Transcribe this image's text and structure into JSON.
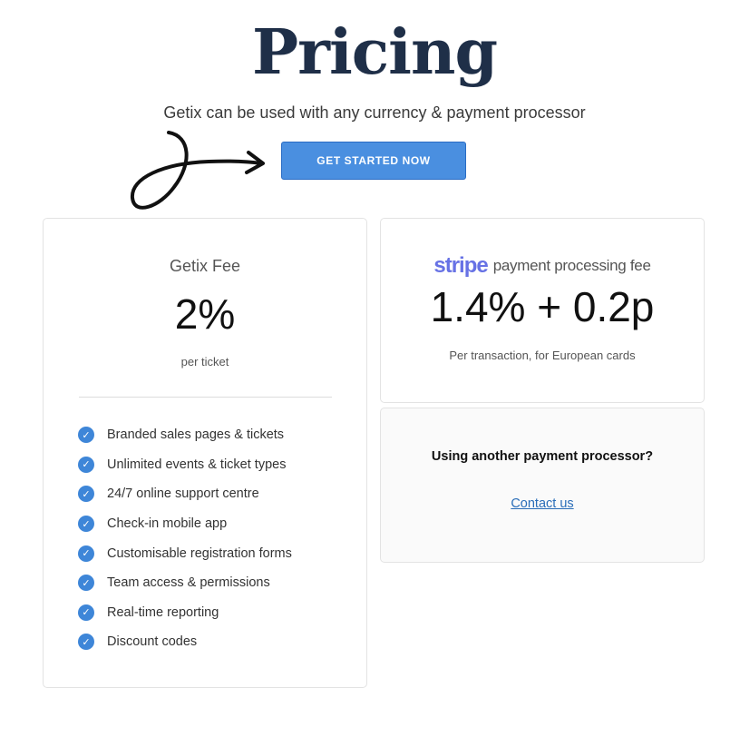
{
  "header": {
    "title": "Pricing",
    "subtitle": "Getix can be used with any currency & payment processor",
    "cta_label": "GET STARTED NOW"
  },
  "fee_card": {
    "label": "Getix Fee",
    "value": "2%",
    "unit": "per ticket",
    "features": [
      "Branded sales pages & tickets",
      "Unlimited events & ticket types",
      "24/7 online support centre",
      "Check-in mobile app",
      "Customisable registration forms",
      "Team access & permissions",
      "Real-time reporting",
      "Discount codes"
    ]
  },
  "stripe_card": {
    "logo": "stripe",
    "suffix": "payment processing fee",
    "value": "1.4% + 0.2p",
    "unit": "Per transaction, for European cards"
  },
  "other_card": {
    "question": "Using another payment processor?",
    "link": "Contact us"
  },
  "colors": {
    "title": "#1f2f48",
    "cta": "#4a8fe0",
    "check": "#3e86d8",
    "stripe": "#6772e5",
    "link": "#2a6db8"
  },
  "icons": {
    "arrow": "hand-drawn-arrow-icon",
    "check": "check-circle-icon"
  }
}
